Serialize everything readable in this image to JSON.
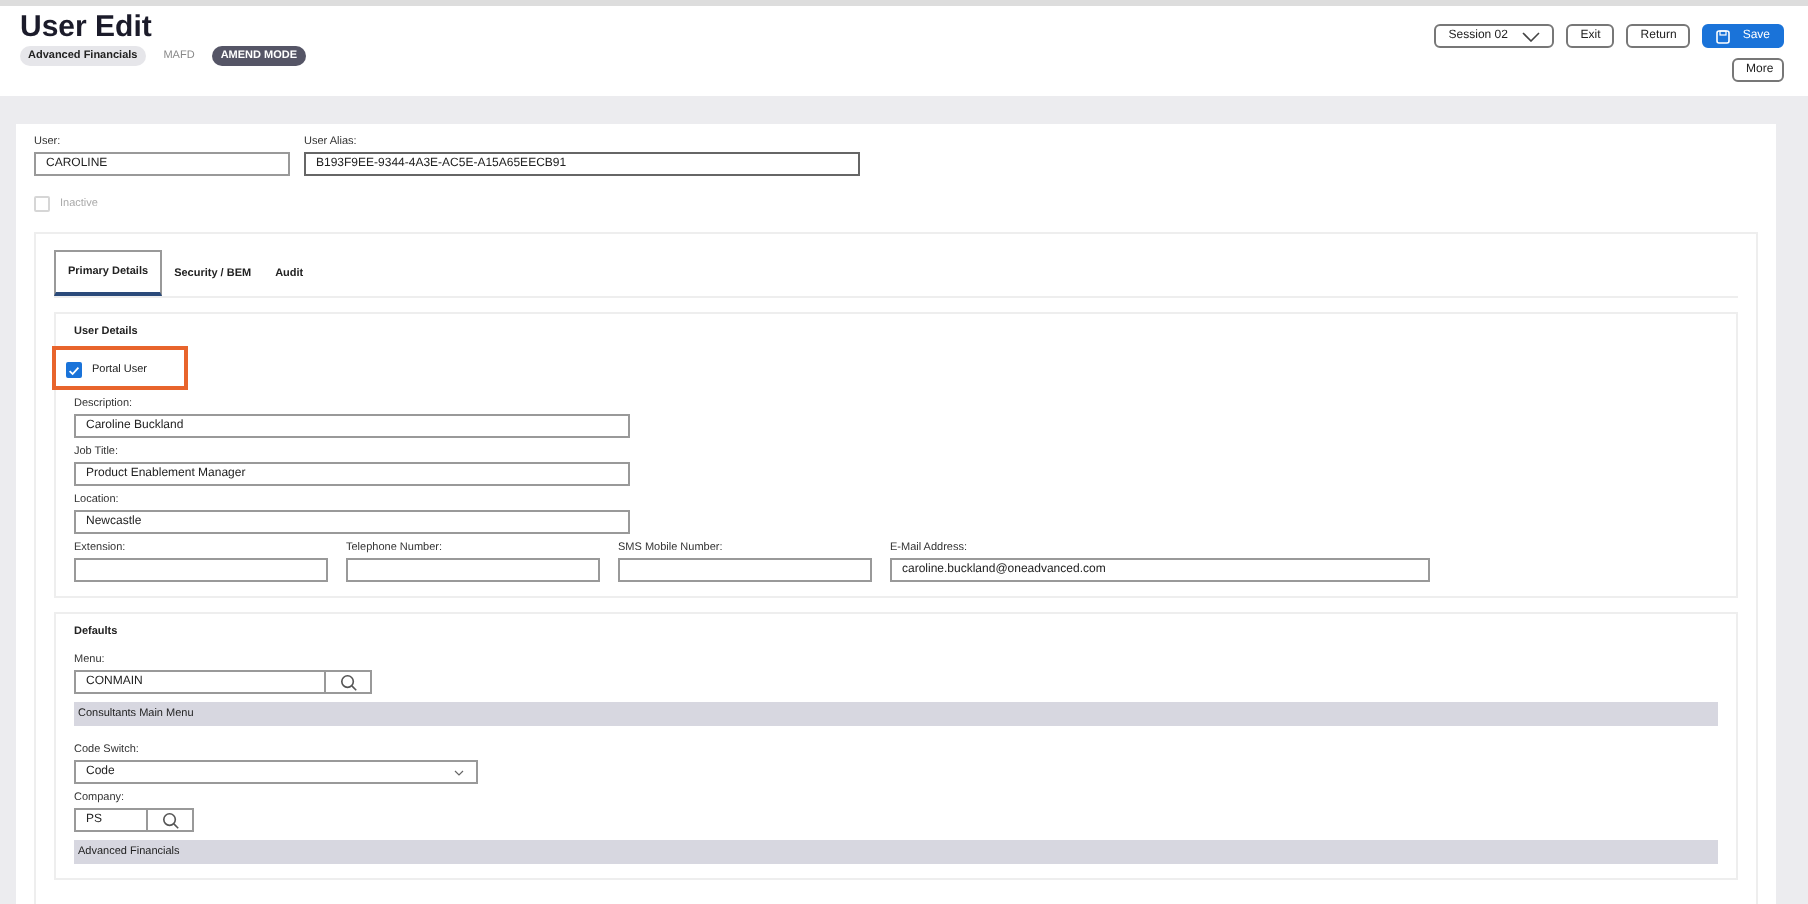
{
  "header": {
    "title": "User Edit",
    "tags": [
      {
        "label": "Advanced Financials",
        "kind": "pill"
      },
      {
        "label": "MAFD",
        "kind": "plain"
      },
      {
        "label": "AMEND MODE",
        "kind": "dark"
      }
    ]
  },
  "actions": {
    "session": "Session 02",
    "buttons": [
      {
        "label": "Exit",
        "kind": "plain"
      },
      {
        "label": "Return",
        "kind": "plain"
      },
      {
        "label": "Save",
        "kind": "primary"
      }
    ],
    "more": "More"
  },
  "user": {
    "label": "User:",
    "value": "CAROLINE"
  },
  "alias": {
    "label": "User Alias:",
    "value": "B193F9EE-9344-4A3E-AC5E-A15A65EECB91"
  },
  "inactive": {
    "label": "Inactive",
    "checked": false,
    "disabled": true
  },
  "tabs": [
    {
      "label": "Primary Details",
      "selected": true
    },
    {
      "label": "Security / BEM",
      "selected": false
    },
    {
      "label": "Audit",
      "selected": false
    }
  ],
  "user_details": {
    "title": "User Details",
    "portal_user": {
      "label": "Portal User",
      "checked": true
    },
    "fields": [
      {
        "label": "Description:",
        "value": "Caroline Buckland"
      },
      {
        "label": "Job Title:",
        "value": "Product Enablement Manager"
      },
      {
        "label": "Location:",
        "value": "Newcastle"
      }
    ],
    "contact_fields": [
      {
        "label": "Extension:",
        "kind": "short"
      },
      {
        "label": "Telephone Number:",
        "kind": "short"
      },
      {
        "label": "SMS Mobile Number:",
        "kind": "short"
      },
      {
        "label": "E-Mail Address:",
        "value": "caroline.buckland@oneadvanced.com",
        "kind": "long"
      }
    ]
  },
  "defaults": {
    "title": "Defaults",
    "menu": {
      "label": "Menu:",
      "value": "CONMAIN",
      "description": "Consultants Main Menu"
    },
    "code_switch": {
      "label": "Code Switch:",
      "value": "Code"
    },
    "company": {
      "label": "Company:",
      "value": "PS",
      "description": "Advanced Financials"
    }
  }
}
